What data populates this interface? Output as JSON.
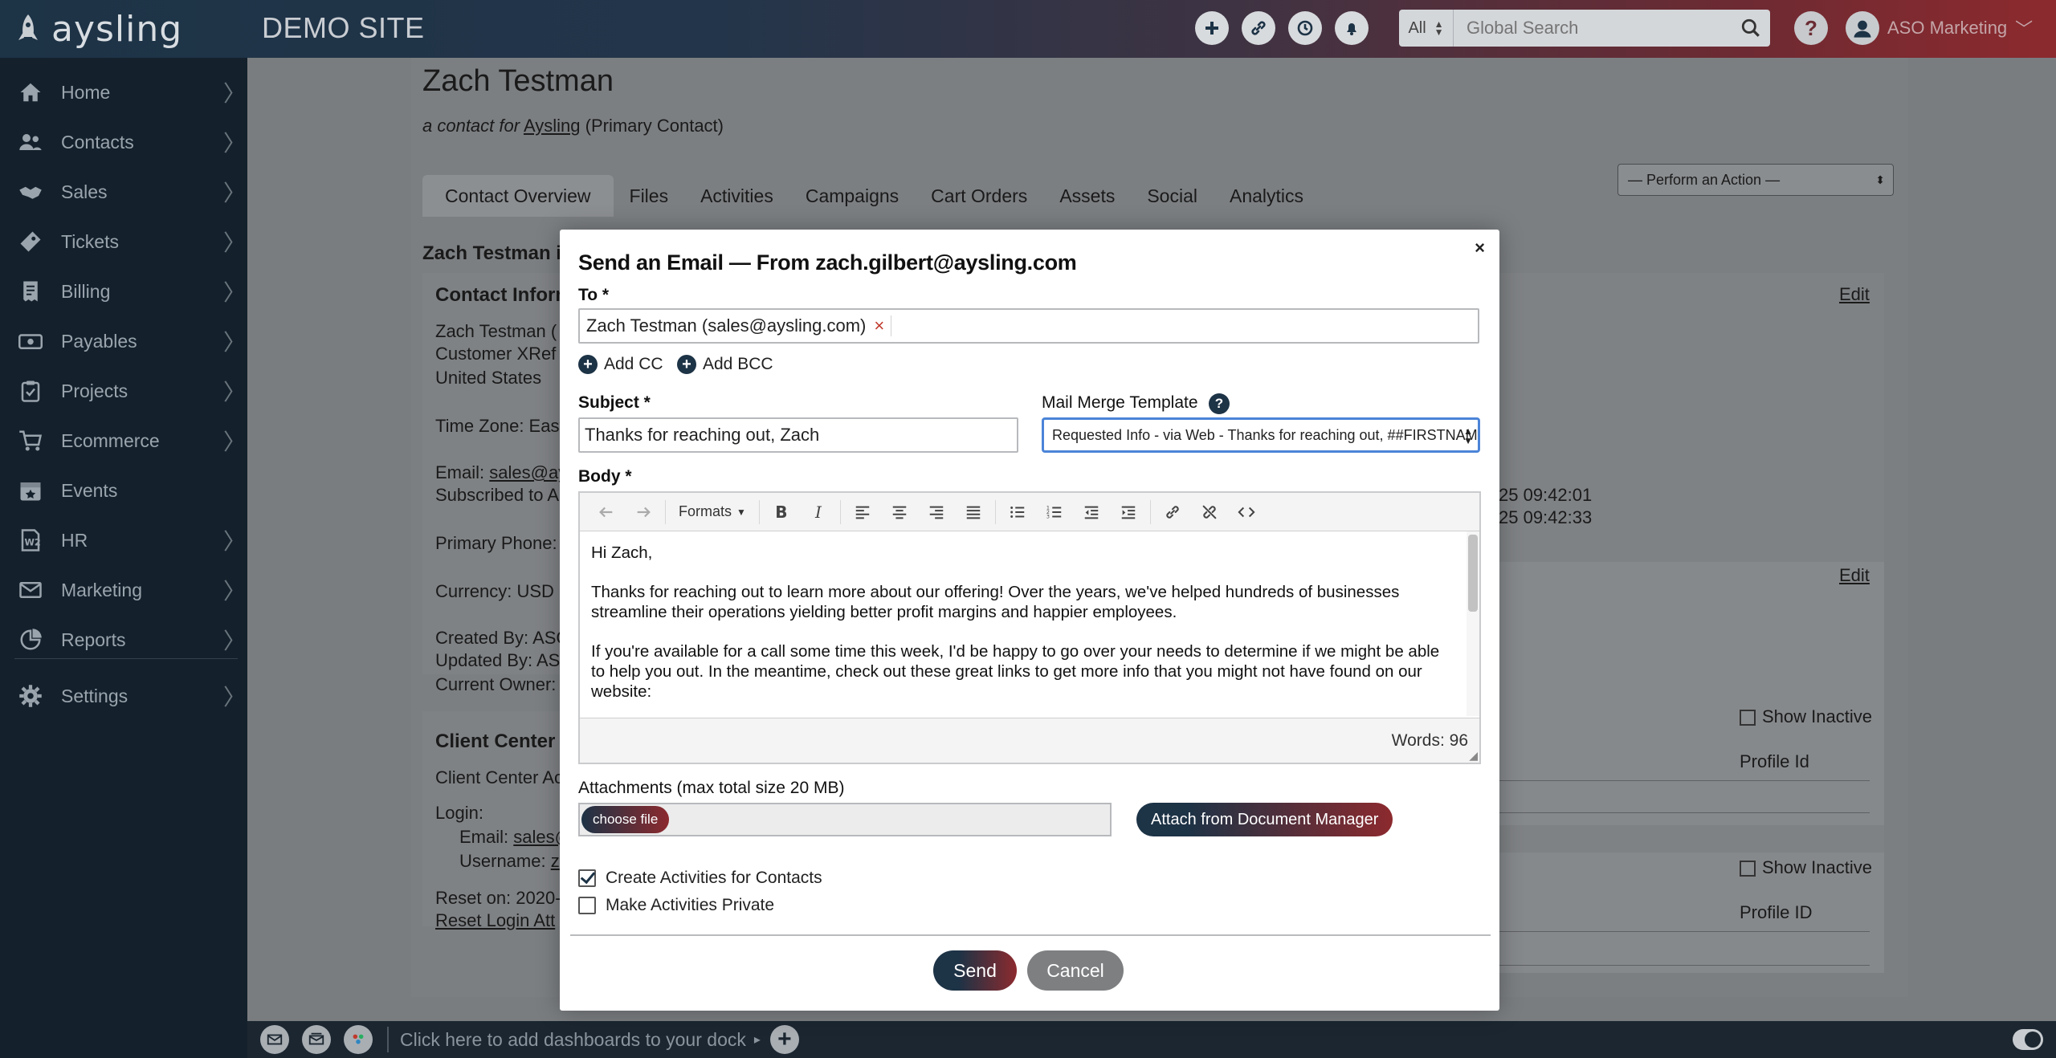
{
  "brand": {
    "logo_text": "aysling",
    "site_name": "DEMO SITE"
  },
  "topbar": {
    "search_scope": "All",
    "search_placeholder": "Global Search",
    "help_label": "?",
    "user_name": "ASO Marketing"
  },
  "sidebar": {
    "items": [
      {
        "label": "Home",
        "icon": "home-icon"
      },
      {
        "label": "Contacts",
        "icon": "users-icon"
      },
      {
        "label": "Sales",
        "icon": "handshake-icon"
      },
      {
        "label": "Tickets",
        "icon": "ticket-icon"
      },
      {
        "label": "Billing",
        "icon": "invoice-icon"
      },
      {
        "label": "Payables",
        "icon": "money-icon"
      },
      {
        "label": "Projects",
        "icon": "clipboard-icon"
      },
      {
        "label": "Ecommerce",
        "icon": "cart-icon"
      },
      {
        "label": "Events",
        "icon": "calendar-icon"
      },
      {
        "label": "HR",
        "icon": "w2-form-icon"
      },
      {
        "label": "Marketing",
        "icon": "envelope-icon"
      },
      {
        "label": "Reports",
        "icon": "chart-icon"
      },
      {
        "label": "Settings",
        "icon": "gear-icon"
      }
    ],
    "chevron": "〉",
    "collapse": "«"
  },
  "contact": {
    "name": "Zach Testman",
    "sub_prefix": "a contact for",
    "company": "Aysling",
    "sub_suffix": "(Primary Contact)",
    "action_select": "— Perform an Action —"
  },
  "tabs": [
    "Contact Overview",
    "Files",
    "Activities",
    "Campaigns",
    "Cart Orders",
    "Assets",
    "Social",
    "Analytics"
  ],
  "background": {
    "status_heading": "Zach Testman is",
    "contact_info_heading": "Contact Informa",
    "name_line": "Zach Testman (",
    "xref_line": "Customer XRef",
    "country": "United States",
    "timezone": "Time Zone: East",
    "email_label": "Email:",
    "email_value": "sales@ay",
    "subscribed": "Subscribed to A",
    "phone": "Primary Phone:",
    "currency": "Currency: USD",
    "created": "Created By: ASC",
    "updated": "Updated By: AS",
    "owner": "Current Owner:",
    "client_heading": "Client Center Inf",
    "client_access": "Client Center Ac",
    "login": "Login:",
    "login_email_label": "Email:",
    "login_email": "sales@",
    "login_username_label": "Username:",
    "login_username": "z",
    "reset_on": "Reset on: 2020-",
    "reset_link": "Reset Login Att",
    "edit1": "Edit",
    "edit2": "Edit",
    "ts1": "25 09:42:01",
    "ts2": "25 09:42:33",
    "show_inactive1": "Show Inactive",
    "profile_id1": "Profile Id",
    "show_inactive2": "Show Inactive",
    "profile_id2": "Profile ID"
  },
  "modal": {
    "close": "×",
    "title": "Send an Email — From zach.gilbert@aysling.com",
    "to_label": "To *",
    "to_recipient": "Zach Testman (sales@aysling.com)",
    "remove": "×",
    "add_cc": "Add CC",
    "add_bcc": "Add BCC",
    "subject_label": "Subject *",
    "subject_value": "Thanks for reaching out, Zach",
    "mm_label": "Mail Merge Template",
    "mm_help": "?",
    "mm_value": "Requested Info - via Web - Thanks for reaching out, ##FIRSTNAME##",
    "body_label": "Body *",
    "toolbar_formats": "Formats",
    "body_paragraphs": [
      "Hi Zach,",
      "Thanks for reaching out to learn more about our offering! Over the years, we've helped hundreds of businesses streamline their operations yielding better profit margins and happier employees.",
      "If you're available for a call some time this week, I'd be happy to go over your needs to determine if we might be able to help you out. In the meantime, check out these great links to get more info that you might not have found on our website:"
    ],
    "word_count": "Words: 96",
    "attachments_label": "Attachments (max total size 20 MB)",
    "choose_file": "choose file",
    "doc_manager": "Attach from Document Manager",
    "create_activities": "Create Activities for Contacts",
    "create_activities_checked": true,
    "private_activities": "Make Activities Private",
    "private_activities_checked": false,
    "send": "Send",
    "cancel": "Cancel"
  },
  "dock": {
    "text": "Click here to add dashboards to your dock",
    "arrow": "▸"
  },
  "colors": {
    "brand_navy": "#1d3346",
    "brand_red": "#8c2a2e",
    "focus_blue": "#4b84d8"
  }
}
